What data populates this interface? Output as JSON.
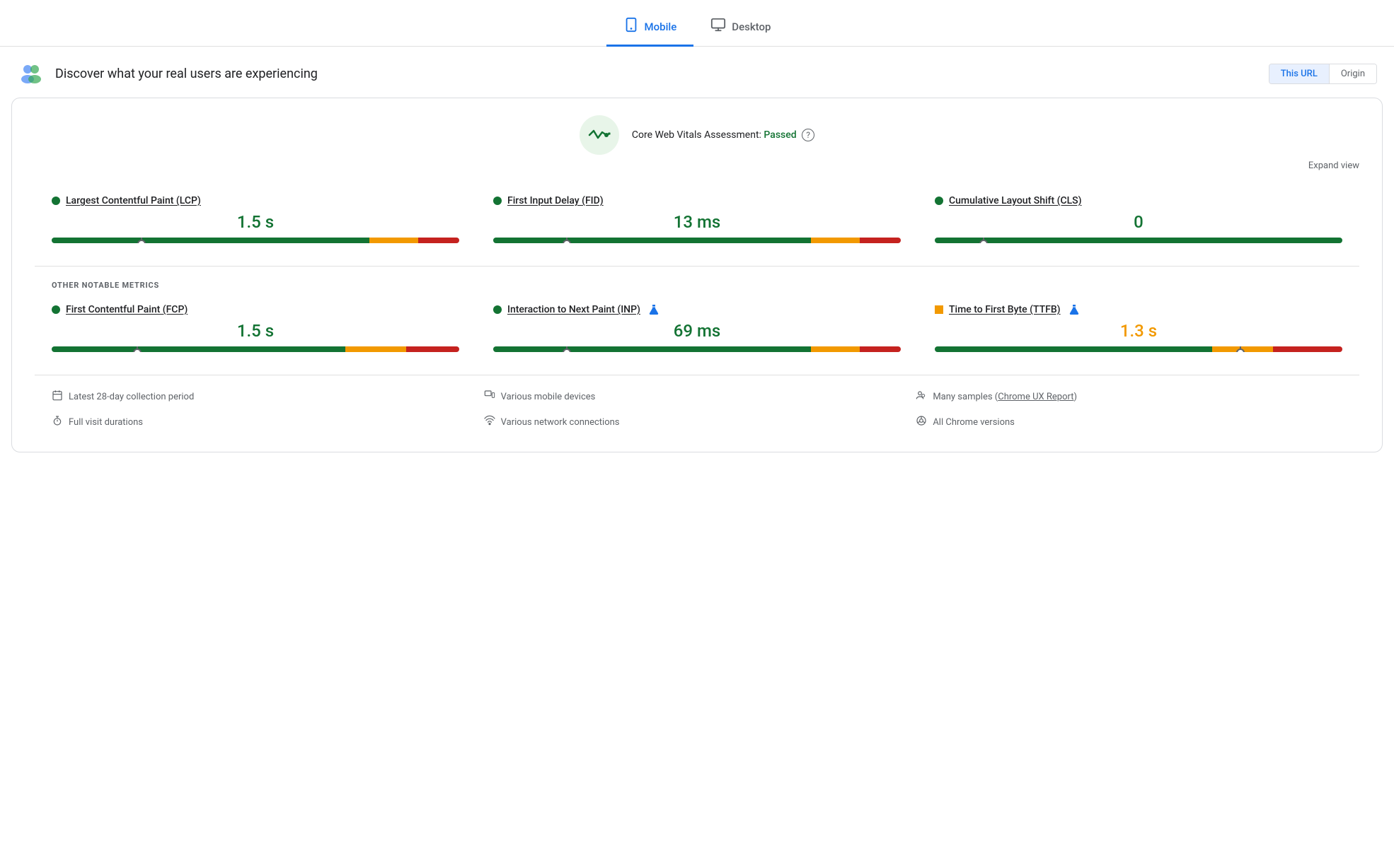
{
  "tabs": [
    {
      "id": "mobile",
      "label": "Mobile",
      "active": true,
      "icon": "📱"
    },
    {
      "id": "desktop",
      "label": "Desktop",
      "active": false,
      "icon": "🖥"
    }
  ],
  "section": {
    "title": "Discover what your real users are experiencing",
    "url_button": "This URL",
    "origin_button": "Origin"
  },
  "cwv": {
    "assessment_label": "Core Web Vitals Assessment:",
    "status": "Passed",
    "expand_label": "Expand view",
    "help": "?"
  },
  "metrics": [
    {
      "id": "lcp",
      "label": "Largest Contentful Paint (LCP)",
      "value": "1.5 s",
      "status": "good",
      "bar": {
        "green": 78,
        "orange": 12,
        "red": 10,
        "marker": 22
      }
    },
    {
      "id": "fid",
      "label": "First Input Delay (FID)",
      "value": "13 ms",
      "status": "good",
      "bar": {
        "green": 78,
        "orange": 12,
        "red": 10,
        "marker": 18
      }
    },
    {
      "id": "cls",
      "label": "Cumulative Layout Shift (CLS)",
      "value": "0",
      "status": "good",
      "bar": {
        "green": 100,
        "orange": 0,
        "red": 0,
        "marker": 12
      }
    }
  ],
  "notable_label": "OTHER NOTABLE METRICS",
  "notable_metrics": [
    {
      "id": "fcp",
      "label": "First Contentful Paint (FCP)",
      "value": "1.5 s",
      "status": "good",
      "dot": "green",
      "bar": {
        "green": 72,
        "orange": 15,
        "red": 13,
        "marker": 21
      },
      "lab": false
    },
    {
      "id": "inp",
      "label": "Interaction to Next Paint (INP)",
      "value": "69 ms",
      "status": "good",
      "dot": "green",
      "bar": {
        "green": 78,
        "orange": 12,
        "red": 10,
        "marker": 18
      },
      "lab": true
    },
    {
      "id": "ttfb",
      "label": "Time to First Byte (TTFB)",
      "value": "1.3 s",
      "status": "needs-improvement",
      "dot": "orange",
      "bar": {
        "green": 68,
        "orange": 15,
        "red": 17,
        "marker": 75
      },
      "lab": true
    }
  ],
  "footer": {
    "items": [
      {
        "icon": "📅",
        "text": "Latest 28-day collection period"
      },
      {
        "icon": "🖥",
        "text": "Various mobile devices"
      },
      {
        "icon": "👥",
        "text": "Many samples (",
        "link": "Chrome UX Report",
        "after": ")"
      },
      {
        "icon": "⏱",
        "text": "Full visit durations"
      },
      {
        "icon": "📶",
        "text": "Various network connections"
      },
      {
        "icon": "🌐",
        "text": "All Chrome versions"
      }
    ]
  },
  "colors": {
    "green": "#137333",
    "orange": "#f29900",
    "red": "#c5221f",
    "blue": "#1a73e8"
  }
}
